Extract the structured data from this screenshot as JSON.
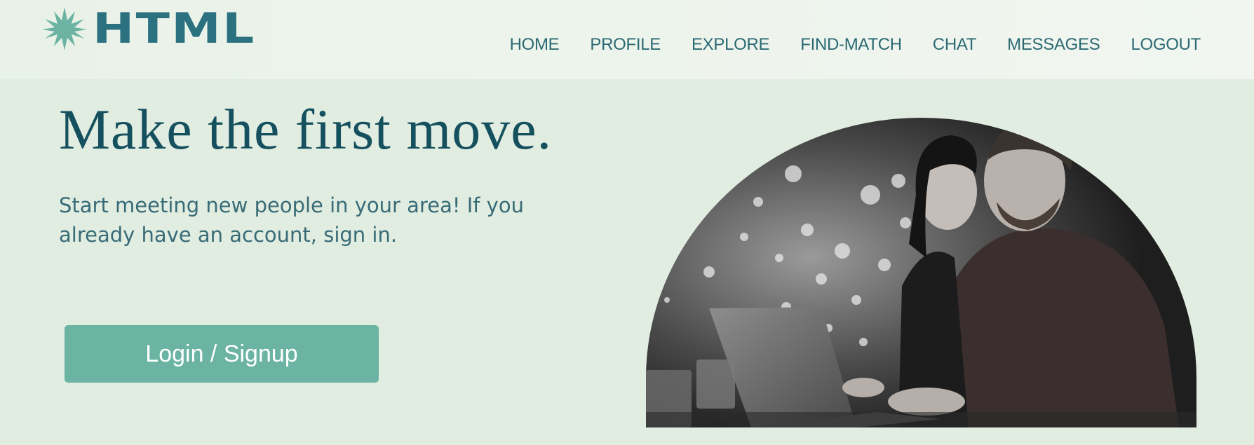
{
  "brand": {
    "logo_text": "HTML",
    "logo_icon": "star-icon",
    "accent": "#2b7180"
  },
  "nav": {
    "items": [
      {
        "label": "HOME"
      },
      {
        "label": "PROFILE"
      },
      {
        "label": "EXPLORE"
      },
      {
        "label": "FIND-MATCH"
      },
      {
        "label": "CHAT"
      },
      {
        "label": "MESSAGES"
      },
      {
        "label": "LOGOUT"
      }
    ]
  },
  "hero": {
    "headline": "Make the first move.",
    "subtext": "Start meeting new people in your area! If you already have an account, sign in.",
    "cta_label": "Login / Signup",
    "cta_color": "#6bb3a3",
    "image": "couple-laptop-photo"
  },
  "colors": {
    "background": "#e1ede0",
    "header": "#eef4ed",
    "text": "#15505f"
  }
}
